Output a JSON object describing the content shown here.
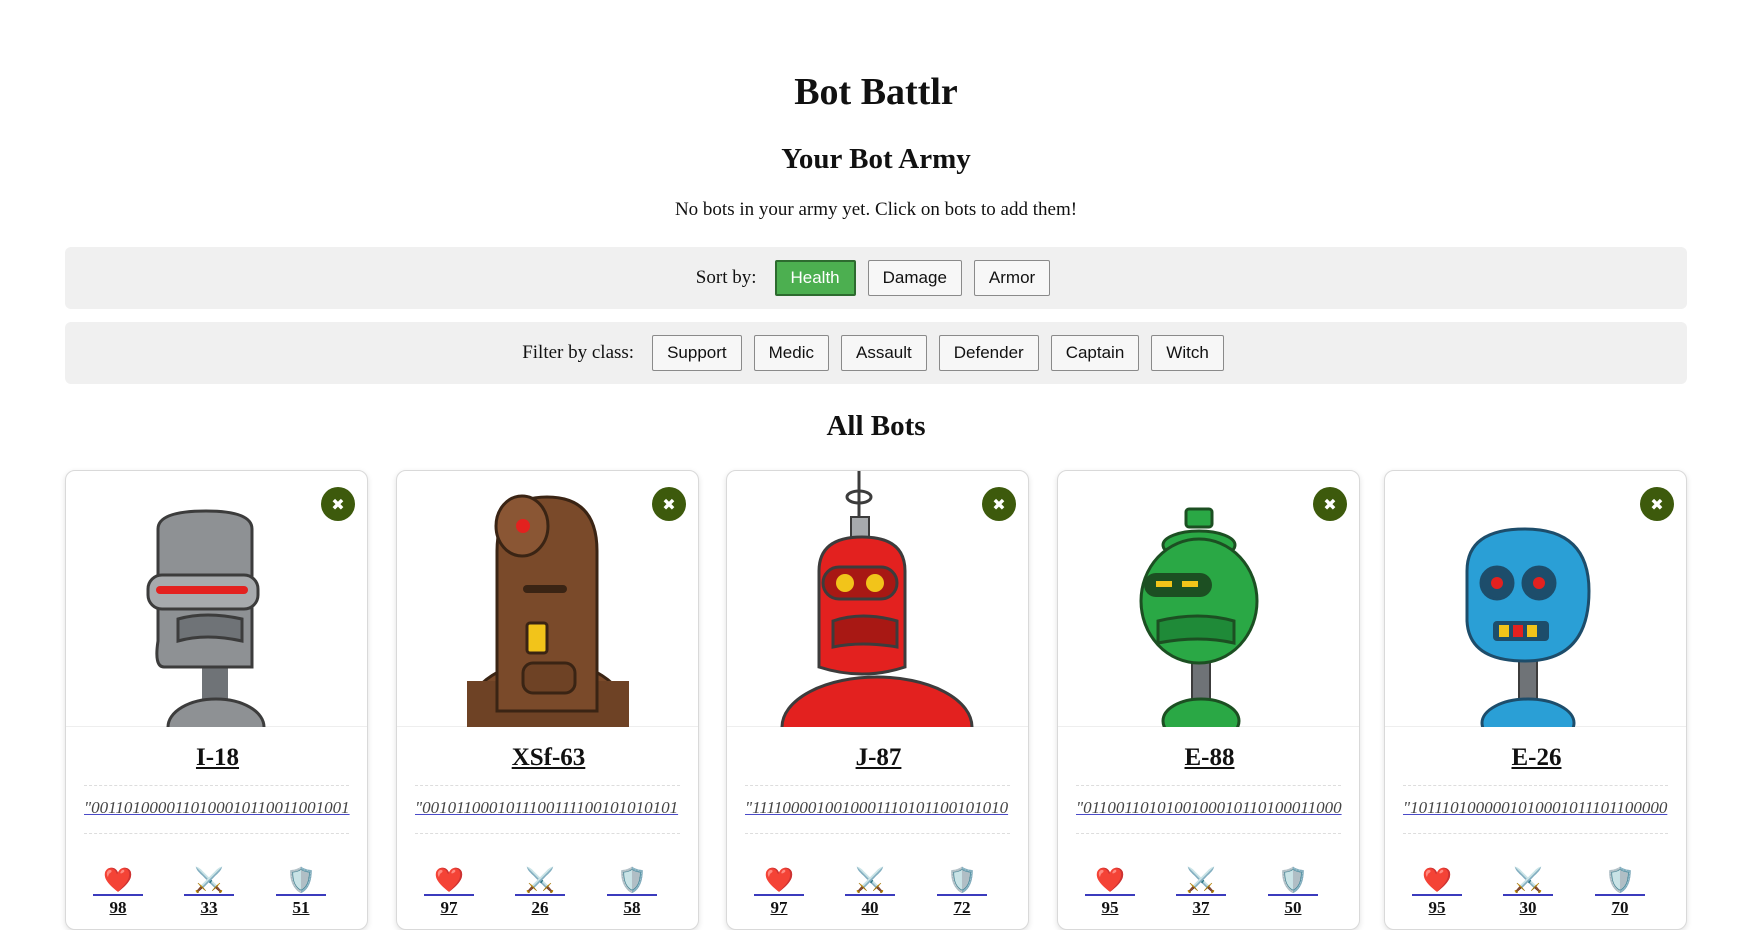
{
  "title": "Bot Battlr",
  "army": {
    "heading": "Your Bot Army",
    "empty_message": "No bots in your army yet. Click on bots to add them!"
  },
  "sort": {
    "label": "Sort by:",
    "options": [
      "Health",
      "Damage",
      "Armor"
    ],
    "active": "Health"
  },
  "filter": {
    "label": "Filter by class:",
    "options": [
      "Support",
      "Medic",
      "Assault",
      "Defender",
      "Captain",
      "Witch"
    ]
  },
  "all_bots_heading": "All Bots",
  "icons": {
    "health": "heart-icon",
    "damage": "crossed-swords-icon",
    "armor": "shield-icon",
    "close": "close-icon"
  },
  "bots": [
    {
      "name": "I-18",
      "catchphrase": "\"0011010000110100010110011001001",
      "health": "98",
      "damage": "33",
      "armor": "51",
      "color": "#8e9194"
    },
    {
      "name": "XSf-63",
      "catchphrase": "\"0010110001011100111100101010101",
      "health": "97",
      "damage": "26",
      "armor": "58",
      "color": "#7a4a2a"
    },
    {
      "name": "J-87",
      "catchphrase": "\"1111000010010001110101100101010",
      "health": "97",
      "damage": "40",
      "armor": "72",
      "color": "#e3211f"
    },
    {
      "name": "E-88",
      "catchphrase": "\"0110011010100100010110100011000",
      "health": "95",
      "damage": "37",
      "armor": "50",
      "color": "#2aa845"
    },
    {
      "name": "E-26",
      "catchphrase": "\"1011101000001010001011101100000",
      "health": "95",
      "damage": "30",
      "armor": "70",
      "color": "#2a9fd6"
    }
  ]
}
